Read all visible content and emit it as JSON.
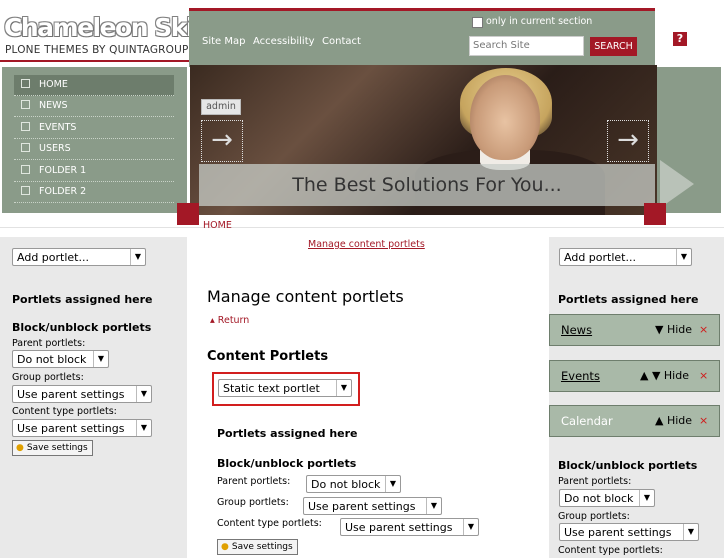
{
  "header": {
    "logo_title": "Chameleon Skin",
    "logo_subtitle": "PLONE THEMES BY QUINTAGROUP",
    "links": [
      "Site Map",
      "Accessibility",
      "Contact"
    ],
    "only_current_section": "only in current section",
    "search_placeholder": "Search Site",
    "search_button": "SEARCH",
    "help_glyph": "?"
  },
  "nav": {
    "items": [
      "HOME",
      "NEWS",
      "EVENTS",
      "USERS",
      "FOLDER 1",
      "FOLDER 2"
    ]
  },
  "banner": {
    "admin_tab": "admin",
    "tagline": "The Best Solutions For You...",
    "prev_glyph": "→",
    "next_glyph": "→"
  },
  "breadcrumb": "HOME",
  "left": {
    "add_portlet": "Add portlet...",
    "assigned_here": "Portlets assigned here",
    "block_heading": "Block/unblock portlets",
    "parent_label": "Parent portlets:",
    "parent_value": "Do not block",
    "group_label": "Group portlets:",
    "group_value": "Use parent settings",
    "content_type_label": "Content type portlets:",
    "content_type_value": "Use parent settings",
    "save": "Save settings"
  },
  "main": {
    "manage_link": "Manage content portlets",
    "title": "Manage content portlets",
    "return": "Return",
    "content_portlets": "Content Portlets",
    "static_select": "Static text portlet",
    "assigned_here": "Portlets assigned here",
    "block_heading": "Block/unblock portlets",
    "parent_label": "Parent portlets:",
    "parent_value": "Do not block",
    "group_label": "Group portlets:",
    "group_value": "Use parent settings",
    "content_type_label": "Content type portlets:",
    "content_type_value": "Use parent settings",
    "save": "Save settings"
  },
  "right": {
    "add_portlet": "Add portlet...",
    "assigned_here": "Portlets assigned here",
    "portlets": [
      {
        "name": "News",
        "controls": "▼ Hide",
        "x": "×"
      },
      {
        "name": "Events",
        "controls": "▲ ▼ Hide",
        "x": "×"
      },
      {
        "name": "Calendar",
        "controls": "▲ Hide",
        "x": "×"
      }
    ],
    "block_heading": "Block/unblock portlets",
    "parent_label": "Parent portlets:",
    "parent_value": "Do not block",
    "group_label": "Group portlets:",
    "group_value": "Use parent settings",
    "content_type_label": "Content type portlets:"
  },
  "colors": {
    "brand_red": "#a31826",
    "sage": "#8a9b89",
    "sidebar_grey": "#e9e9e9"
  }
}
